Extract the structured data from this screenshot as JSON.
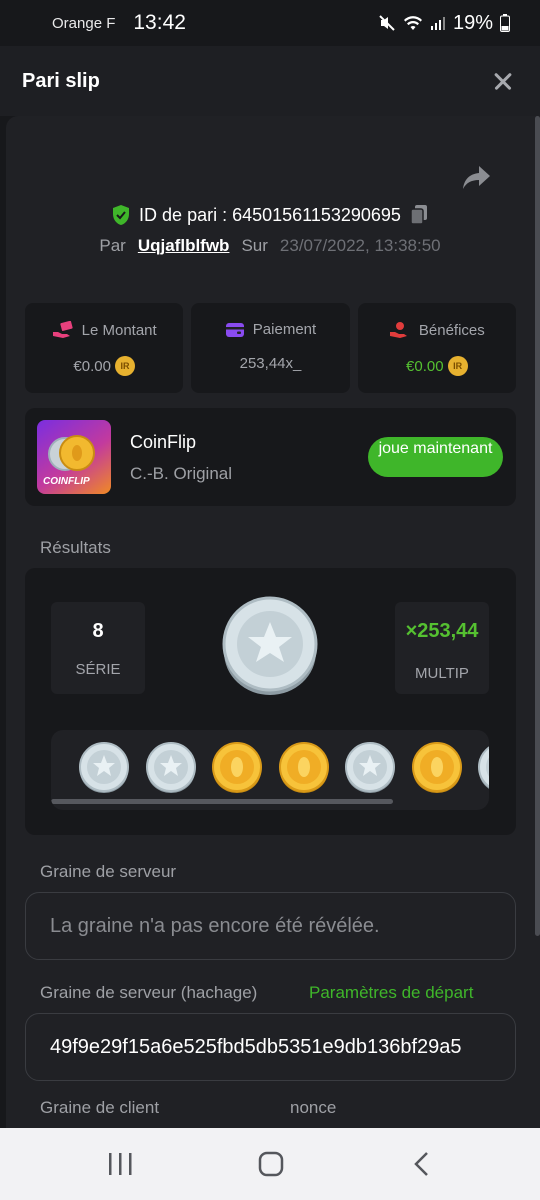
{
  "status_bar": {
    "carrier": "Orange F",
    "time": "13:42",
    "battery": "19%"
  },
  "header": {
    "title": "Pari slip"
  },
  "bet": {
    "id_label": "ID de pari : 64501561153290695",
    "by_label": "Par",
    "user": "Uqjaflblfwb",
    "on_label": "Sur",
    "date": "23/07/2022, 13:38:50"
  },
  "stats": [
    {
      "label": "Le Montant",
      "value": "€0.00",
      "color": "#e8407d"
    },
    {
      "label": "Paiement",
      "value": "253,44x_",
      "color": "#8a4bf0"
    },
    {
      "label": "Bénéfices",
      "value": "€0.00",
      "color": "#e03c3c"
    }
  ],
  "game": {
    "name": "CoinFlip",
    "provider": "C.-B. Original",
    "thumb_label": "COINFLIP",
    "play_label": "joue maintenant"
  },
  "results": {
    "label": "Résultats",
    "streak_value": "8",
    "streak_label": "SÉRIE",
    "multiplier_value": "×253,44",
    "multiplier_label": "MULTIP",
    "coins": [
      "silver",
      "silver",
      "gold",
      "gold",
      "silver",
      "gold",
      "silver"
    ]
  },
  "server_seed": {
    "label": "Graine de serveur",
    "placeholder": "La graine n'a pas encore été révélée."
  },
  "server_hash": {
    "label": "Graine de serveur (hachage)",
    "link": "Paramètres de départ",
    "value": "49f9e29f15a6e525fbd5db5351e9db136bf29a5"
  },
  "client_seed": {
    "label": "Graine de client"
  },
  "nonce": {
    "label": "nonce"
  },
  "colors": {
    "accent_green": "#3fb62a",
    "win_green": "#55c131",
    "shield": "#3fb62a"
  }
}
